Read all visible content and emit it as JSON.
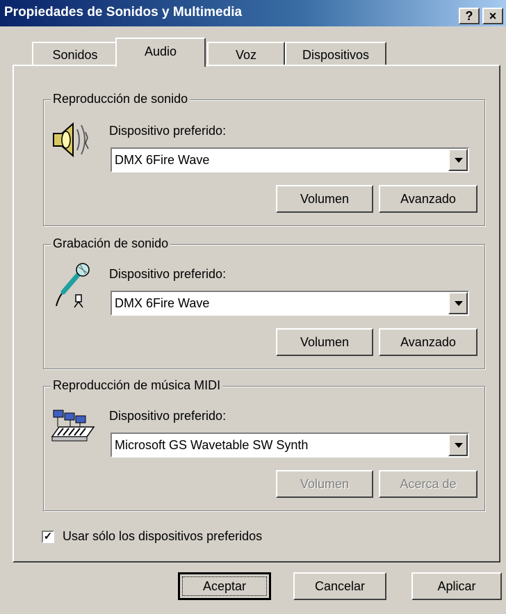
{
  "window": {
    "title": "Propiedades de Sonidos y Multimedia",
    "help_glyph": "?",
    "close_glyph": "×"
  },
  "tabs": [
    {
      "label": "Sonidos",
      "active": false
    },
    {
      "label": "Audio",
      "active": true
    },
    {
      "label": "Voz",
      "active": false
    },
    {
      "label": "Dispositivos",
      "active": false
    }
  ],
  "playback": {
    "group_title": "Reproducción de sonido",
    "device_label": "Dispositivo preferido:",
    "device_value": "DMX 6Fire Wave",
    "volume_label": "Volumen",
    "advanced_label": "Avanzado",
    "icon": "speaker-icon"
  },
  "recording": {
    "group_title": "Grabación de sonido",
    "device_label": "Dispositivo preferido:",
    "device_value": "DMX 6Fire Wave",
    "volume_label": "Volumen",
    "advanced_label": "Avanzado",
    "icon": "microphone-icon"
  },
  "midi": {
    "group_title": "Reproducción de música MIDI",
    "device_label": "Dispositivo preferido:",
    "device_value": "Microsoft GS Wavetable SW Synth",
    "volume_label": "Volumen",
    "about_label": "Acerca de",
    "icon": "midi-keyboard-icon"
  },
  "preferred_only": {
    "label": "Usar sólo los dispositivos preferidos",
    "checked": true,
    "check_glyph": "✓"
  },
  "footer": {
    "ok_label": "Aceptar",
    "cancel_label": "Cancelar",
    "apply_label": "Aplicar"
  },
  "colors": {
    "face": "#d4d0c8",
    "title_start": "#0a246a",
    "title_end": "#a6caf0",
    "disabled_text": "#808080"
  }
}
